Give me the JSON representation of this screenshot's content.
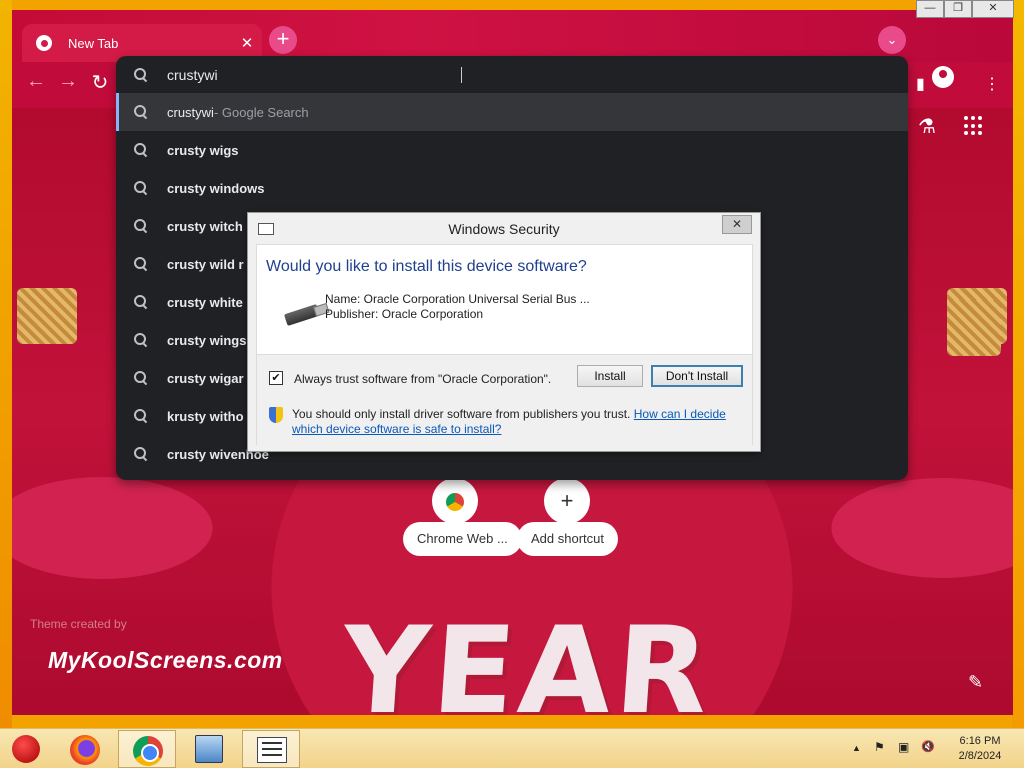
{
  "browser": {
    "tab_title": "New Tab",
    "tab_close": "✕",
    "new_tab": "+",
    "tab_search": "⌄",
    "win_minimize": "—",
    "win_restore": "❐",
    "win_close": "✕",
    "nav_back": "←",
    "nav_forward": "→",
    "nav_reload": "↻"
  },
  "omnibox": {
    "input_value": "crustywi",
    "suggestions": [
      {
        "text": "crustywi",
        "suffix": " - Google Search"
      },
      {
        "text": "crusty wigs"
      },
      {
        "text": "crusty windows"
      },
      {
        "text": "crusty witch"
      },
      {
        "text": "crusty wild r"
      },
      {
        "text": "crusty white"
      },
      {
        "text": "crusty wings"
      },
      {
        "text": "crusty wigar"
      },
      {
        "text": "krusty witho"
      },
      {
        "text": "crusty wivenhoe"
      }
    ]
  },
  "ntp": {
    "shortcuts": [
      {
        "label": "Chrome Web ...",
        "icon": "chrome-icon"
      },
      {
        "label": "Add shortcut",
        "icon": "+"
      }
    ],
    "watermark": "MyKoolScreens.com",
    "theme_credit": "Theme created by",
    "year_text": "YEAR",
    "edit_icon": "✎",
    "lab_icon": "⚗"
  },
  "dialog": {
    "title": "Windows Security",
    "close": "✕",
    "heading": "Would you like to install this device software?",
    "name_line": "Name: Oracle Corporation Universal Serial Bus ...",
    "publisher_line": "Publisher: Oracle Corporation",
    "checkbox_label": "Always trust software from \"Oracle Corporation\".",
    "checkbox_checked": true,
    "checkbox_mark": "✔",
    "install_label": "Install",
    "dont_install_label": "Don't Install",
    "warning_text": "You should only install driver software from publishers you trust.",
    "warning_link": "How can I decide which device software is safe to install?"
  },
  "taskbar": {
    "tray_arrow": "▲",
    "tray_flag": "⚑",
    "tray_network": "▣",
    "tray_volume": "🔇",
    "time": "6:16 PM",
    "date": "2/8/2024"
  },
  "colors": {
    "accent": "#c10c3b",
    "omnibox_bg": "#202124",
    "dialog_heading": "#1f3f8f",
    "link": "#0a58b8"
  }
}
